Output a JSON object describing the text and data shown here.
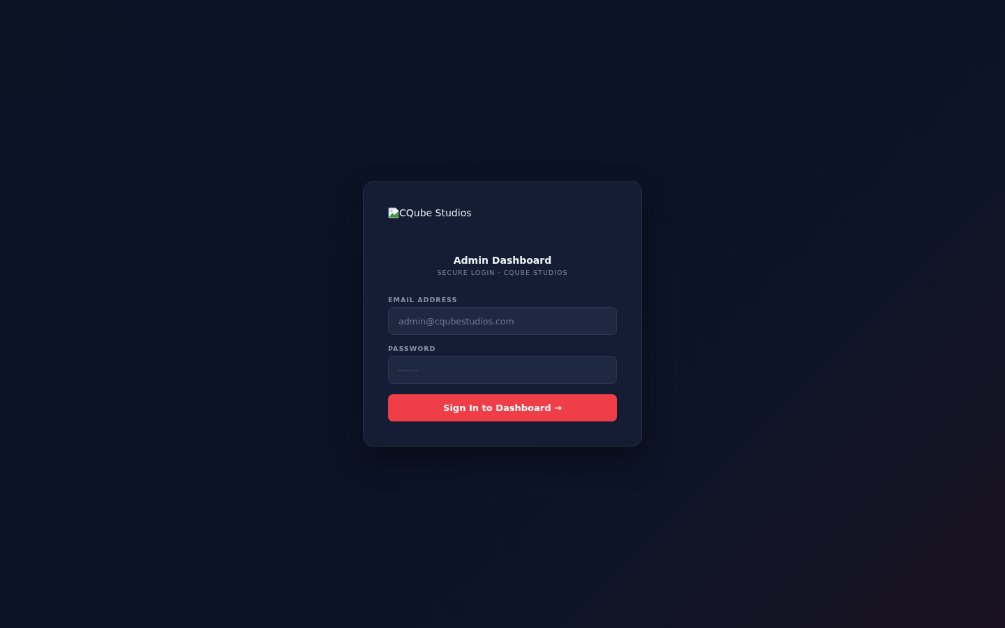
{
  "login_card": {
    "logo": {
      "alt_text": "CQube Studios"
    },
    "title": "Admin Dashboard",
    "subtitle": "SECURE LOGIN · CQUBE STUDIOS",
    "fields": [
      {
        "label": "EMAIL ADDRESS",
        "placeholder": "admin@cqubestudios.com",
        "kind": "email"
      },
      {
        "label": "PASSWORD",
        "placeholder": "········",
        "kind": "password"
      }
    ],
    "submit_button": {
      "label": "Sign In to Dashboard →"
    }
  }
}
